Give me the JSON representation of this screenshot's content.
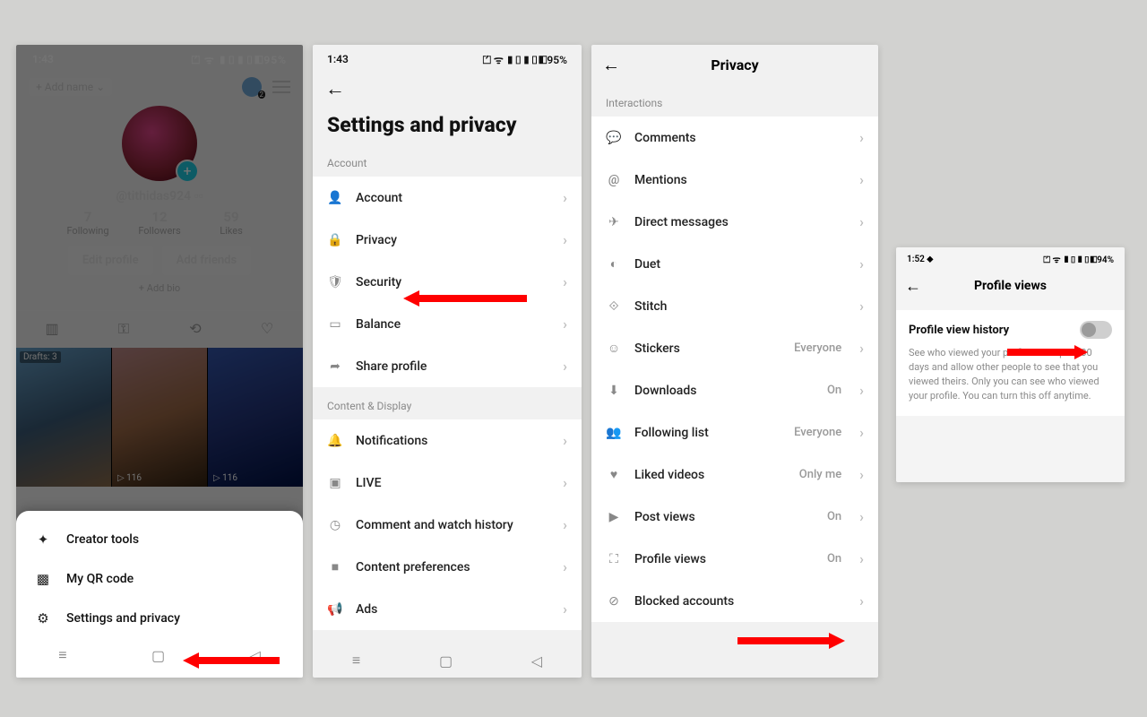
{
  "status": {
    "time": "1:43",
    "icons": "⏍ ᯤ ▮▯▮▯◧95%",
    "time_s4": "1:52 ⬥",
    "icons_s4": "⏍ ᯤ ▮▯▮▯◧94%"
  },
  "screen1": {
    "add_name": "+ Add name  ⌄",
    "handle": "@tithidas924 ▫▫",
    "stats": {
      "following_n": "7",
      "following_l": "Following",
      "followers_n": "12",
      "followers_l": "Followers",
      "likes_n": "59",
      "likes_l": "Likes"
    },
    "edit_profile": "Edit profile",
    "add_friends": "Add friends",
    "add_bio": "+ Add bio",
    "drafts": "Drafts: 3",
    "views1": "▷ 116",
    "views2": "▷ 116",
    "sheet": {
      "creator_tools": "Creator tools",
      "qr": "My QR code",
      "settings": "Settings and privacy"
    }
  },
  "screen2": {
    "title": "Settings and privacy",
    "section_account": "Account",
    "section_content": "Content & Display",
    "rows": {
      "account": "Account",
      "privacy": "Privacy",
      "security": "Security",
      "balance": "Balance",
      "share": "Share profile",
      "notifications": "Notifications",
      "live": "LIVE",
      "history": "Comment and watch history",
      "content_pref": "Content preferences",
      "ads": "Ads"
    }
  },
  "screen3": {
    "title": "Privacy",
    "section": "Interactions",
    "rows": {
      "comments": "Comments",
      "mentions": "Mentions",
      "direct": "Direct messages",
      "duet": "Duet",
      "stitch": "Stitch",
      "stickers": "Stickers",
      "stickers_val": "Everyone",
      "downloads": "Downloads",
      "downloads_val": "On",
      "following": "Following list",
      "following_val": "Everyone",
      "liked": "Liked videos",
      "liked_val": "Only me",
      "post_views": "Post views",
      "post_views_val": "On",
      "profile_views": "Profile views",
      "profile_views_val": "On",
      "blocked": "Blocked accounts"
    }
  },
  "screen4": {
    "title": "Profile views",
    "toggle_label": "Profile view history",
    "desc": "See who viewed your profile in the past 30 days and allow other people to see that you viewed theirs. Only you can see who viewed your profile. You can turn this off anytime."
  }
}
